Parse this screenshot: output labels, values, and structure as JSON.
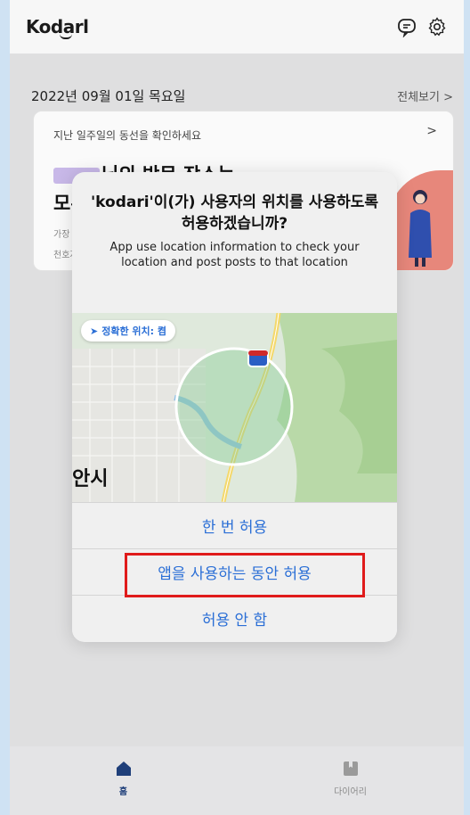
{
  "header": {
    "logo": "Kodarl"
  },
  "date_row": {
    "date": "2022년 09월 01일 목요일",
    "more": "전체보기 >"
  },
  "card": {
    "subtitle": "지난 일주일의 동선을 확인하세요",
    "chevron": ">",
    "title_suffix": "님의 방문 장소는",
    "title_line2": "모두",
    "small1": "가장 !",
    "small2": "천호지"
  },
  "dialog": {
    "title": "'kodari'이(가) 사용자의 위치를 사용하도록 허용하겠습니까?",
    "message": "App use location information to check your location and post posts to that location",
    "precise_location": "정확한 위치: 켬",
    "map_city": "안시",
    "buttons": {
      "allow_once": "한 번 허용",
      "allow_while_using": "앱을 사용하는 동안 허용",
      "dont_allow": "허용 안 함"
    }
  },
  "tabbar": {
    "home_label": "홈",
    "diary_label": "다이어리"
  },
  "colors": {
    "accent_blue": "#2b6fd6",
    "highlight_red": "#e01b1b",
    "nav_active": "#1f3f7a"
  }
}
